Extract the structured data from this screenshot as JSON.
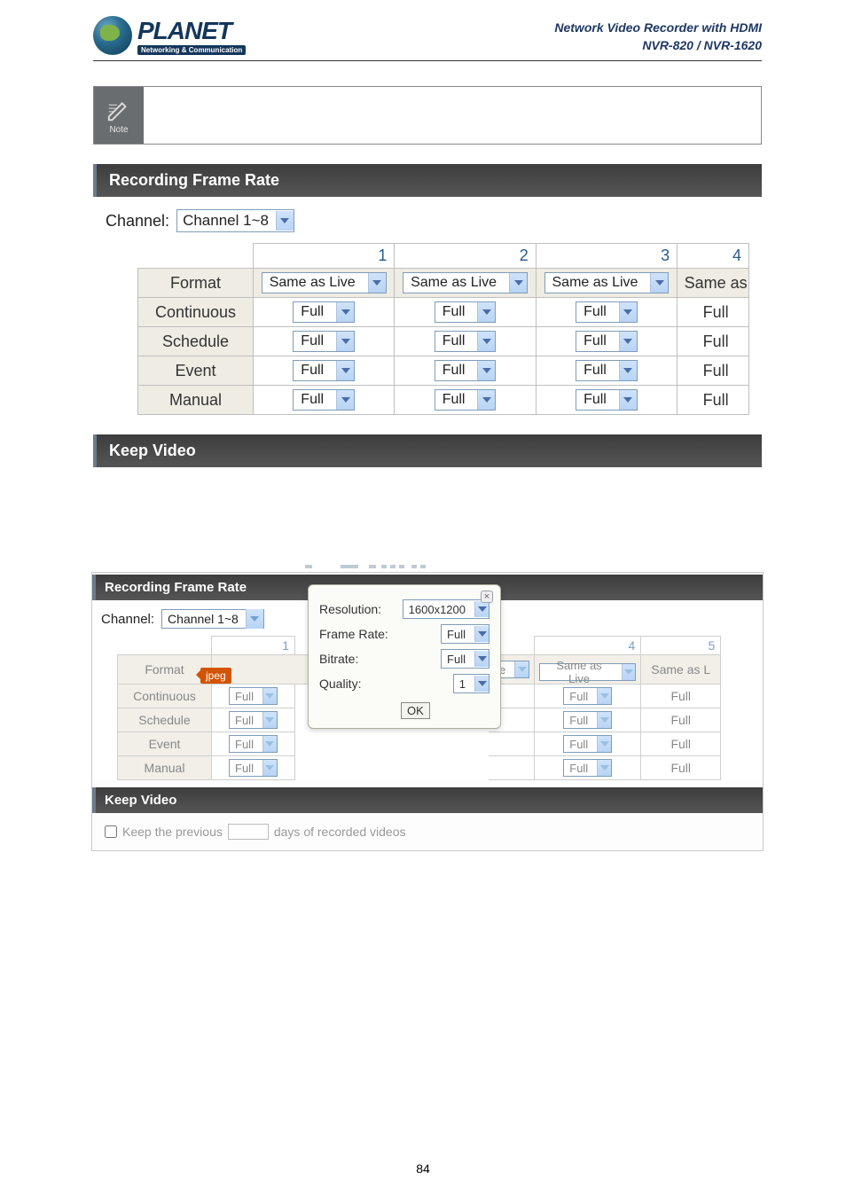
{
  "product": {
    "line1": "Network Video Recorder with HDMI",
    "line2": "NVR-820 / NVR-1620"
  },
  "logo": {
    "main": "PLANET",
    "sub": "Networking & Communication"
  },
  "note_label": "Note",
  "rfr": {
    "title": "Recording Frame Rate",
    "channel_label": "Channel:",
    "channel_value": "Channel 1~8",
    "col_nums": [
      "1",
      "2",
      "3",
      "4"
    ],
    "format_label": "Format",
    "format_cells": [
      "Same as Live",
      "Same as Live",
      "Same as Live",
      "Same as"
    ],
    "rows": [
      {
        "label": "Continuous",
        "cells": [
          "Full",
          "Full",
          "Full",
          "Full"
        ]
      },
      {
        "label": "Schedule",
        "cells": [
          "Full",
          "Full",
          "Full",
          "Full"
        ]
      },
      {
        "label": "Event",
        "cells": [
          "Full",
          "Full",
          "Full",
          "Full"
        ]
      },
      {
        "label": "Manual",
        "cells": [
          "Full",
          "Full",
          "Full",
          "Full"
        ]
      }
    ]
  },
  "keep_video_title": "Keep Video",
  "shot2": {
    "rfr_title": "Recording Frame Rate",
    "channel_label": "Channel:",
    "channel_value": "Channel 1~8",
    "col_nums": [
      "1",
      "4",
      "5"
    ],
    "format_label": "Format",
    "format_tip": "jpeg",
    "format_cells_right": [
      "e",
      "Same as Live",
      "Same as L"
    ],
    "rows": [
      {
        "label": "Continuous",
        "left": "Full",
        "right": [
          "Full",
          "Full"
        ]
      },
      {
        "label": "Schedule",
        "left": "Full",
        "right": [
          "Full",
          "Full"
        ]
      },
      {
        "label": "Event",
        "left": "Full",
        "right": [
          "Full",
          "Full"
        ]
      },
      {
        "label": "Manual",
        "left": "Full",
        "right": [
          "Full",
          "Full"
        ]
      }
    ],
    "keep_video_title": "Keep Video",
    "keep_prev_label": "Keep the previous",
    "keep_days_suffix": "days of recorded videos"
  },
  "popup": {
    "resolution_label": "Resolution:",
    "resolution_value": "1600x1200",
    "framerate_label": "Frame Rate:",
    "framerate_value": "Full",
    "bitrate_label": "Bitrate:",
    "bitrate_value": "Full",
    "quality_label": "Quality:",
    "quality_value": "1",
    "ok": "OK",
    "close": "×"
  },
  "page_number": "84"
}
